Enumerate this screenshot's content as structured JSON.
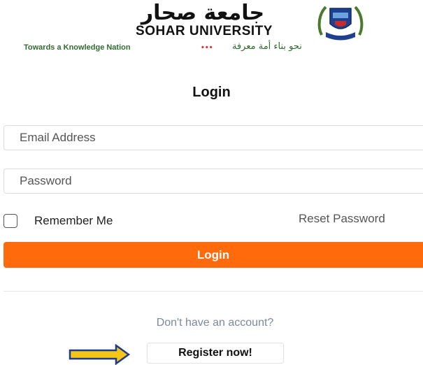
{
  "header": {
    "arabic_name": "جامعة صحار",
    "university_name": "SOHAR UNIVERSITY",
    "tagline": "Towards a Knowledge Nation",
    "tagline_dots": "•••",
    "tagline_arabic": "نحو بناء أمة معرفة"
  },
  "form": {
    "title": "Login",
    "email_placeholder": "Email Address",
    "password_placeholder": "Password",
    "remember_label": "Remember Me",
    "reset_label": "Reset Password",
    "login_button": "Login"
  },
  "footer": {
    "no_account_text": "Don't have an account?",
    "register_button": "Register now!"
  },
  "colors": {
    "accent_orange": "#ff6a0d",
    "tagline_green": "#2f6b2f",
    "arrow_yellow": "#f5c518",
    "arrow_outline": "#1f3a8a"
  }
}
